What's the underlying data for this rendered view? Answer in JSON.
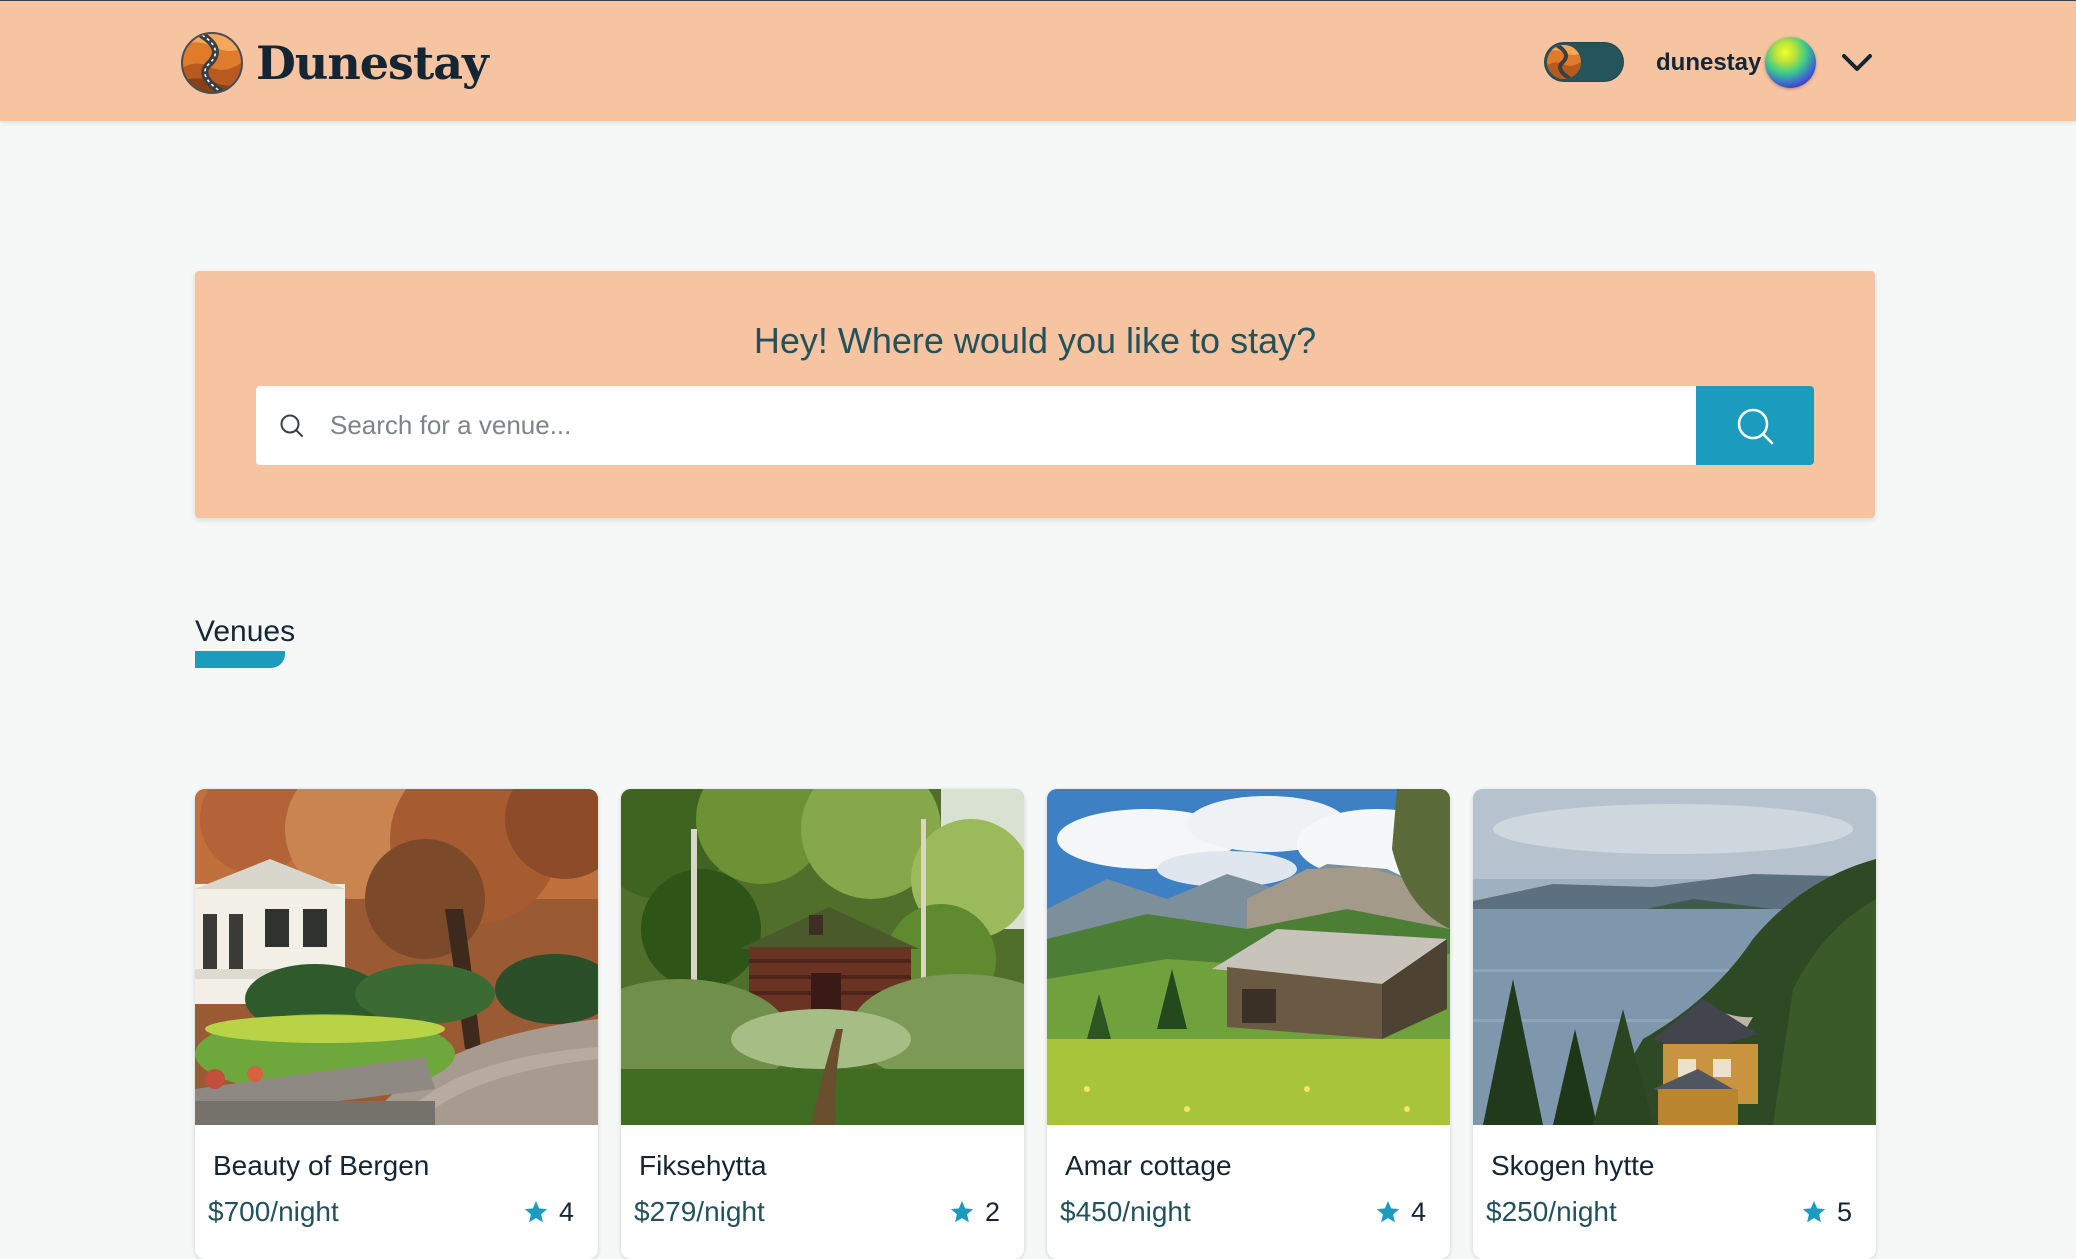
{
  "header": {
    "brand_name": "Dunestay",
    "user_name": "dunestay",
    "icons": [
      "brand-logo-icon",
      "theme-toggle",
      "avatar",
      "chevron-down-icon"
    ]
  },
  "search": {
    "heading": "Hey! Where would you like to stay?",
    "placeholder": "Search for a venue...",
    "value": ""
  },
  "venues_section": {
    "title": "Venues"
  },
  "venues": [
    {
      "name": "Beauty of Bergen",
      "price": "$700/night",
      "rating": "4",
      "image": "house-with-autumn-tree"
    },
    {
      "name": "Fiksehytta",
      "price": "$279/night",
      "rating": "2",
      "image": "log-cabin-in-forest"
    },
    {
      "name": "Amar cottage",
      "price": "$450/night",
      "rating": "4",
      "image": "cottage-on-alpine-meadow"
    },
    {
      "name": "Skogen hytte",
      "price": "$250/night",
      "rating": "5",
      "image": "house-by-fjord"
    }
  ],
  "colors": {
    "header_bg": "#f7c4a1",
    "accent": "#1b9cbf",
    "heading_text": "#22525c",
    "price_text": "#23525c",
    "page_bg": "#f6f8f8"
  }
}
